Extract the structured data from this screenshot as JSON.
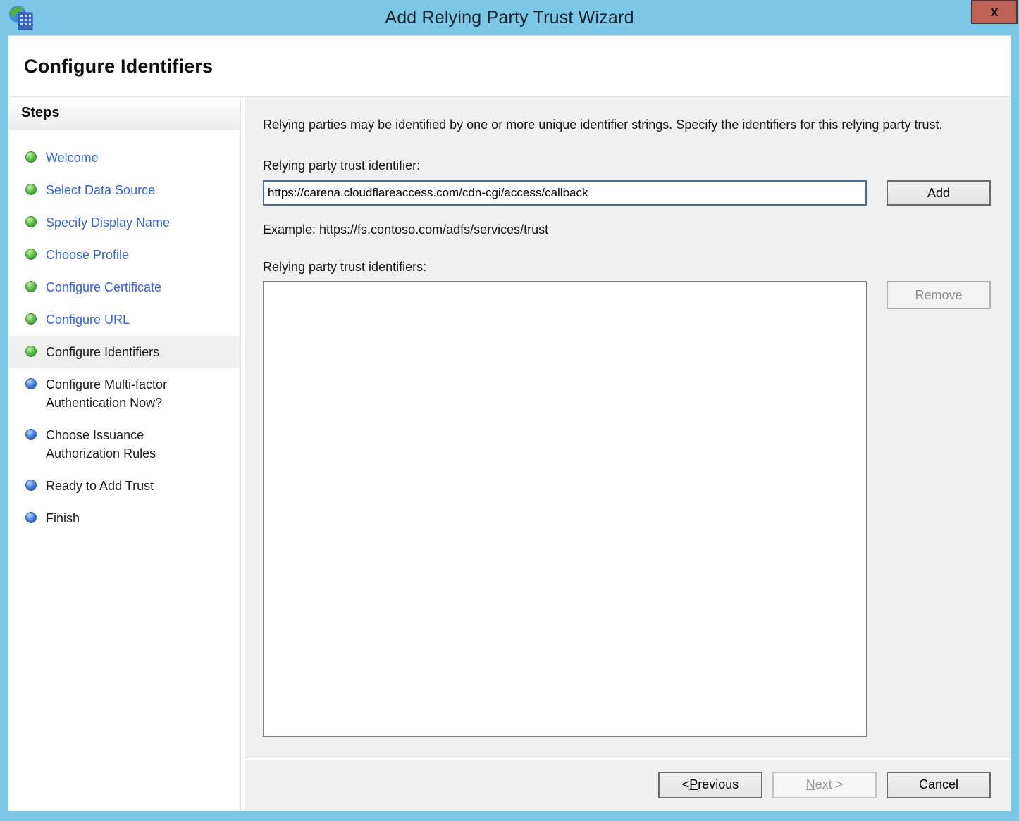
{
  "window": {
    "title": "Add Relying Party Trust Wizard",
    "close_label": "x"
  },
  "page": {
    "heading": "Configure Identifiers"
  },
  "sidebar": {
    "title": "Steps",
    "steps": [
      {
        "label": "Welcome",
        "status": "done"
      },
      {
        "label": "Select Data Source",
        "status": "done"
      },
      {
        "label": "Specify Display Name",
        "status": "done"
      },
      {
        "label": "Choose Profile",
        "status": "done"
      },
      {
        "label": "Configure Certificate",
        "status": "done"
      },
      {
        "label": "Configure URL",
        "status": "done"
      },
      {
        "label": "Configure Identifiers",
        "status": "current"
      },
      {
        "label": "Configure Multi-factor Authentication Now?",
        "status": "pending"
      },
      {
        "label": "Choose Issuance Authorization Rules",
        "status": "pending"
      },
      {
        "label": "Ready to Add Trust",
        "status": "pending"
      },
      {
        "label": "Finish",
        "status": "pending"
      }
    ]
  },
  "main": {
    "intro": "Relying parties may be identified by one or more unique identifier strings. Specify the identifiers for this relying party trust.",
    "identifier_label": "Relying party trust identifier:",
    "identifier_input": {
      "value": "https://carena.cloudflareaccess.com/cdn-cgi/access/callback"
    },
    "add_button": "Add",
    "example": "Example: https://fs.contoso.com/adfs/services/trust",
    "identifiers_list_label": "Relying party trust identifiers:",
    "identifiers": [],
    "remove_button": "Remove"
  },
  "footer": {
    "previous": {
      "pre": "< ",
      "key": "P",
      "rest": "revious"
    },
    "next": {
      "pre": "",
      "key": "N",
      "rest": "ext >"
    },
    "cancel": "Cancel"
  },
  "colors": {
    "titlebar_blue": "#7CC7E6",
    "close_button_red": "#BE6157",
    "completed_link_blue": "#3463E3",
    "completed_dot_green": "#46AC39",
    "pending_dot_blue": "#3A6FD8",
    "focused_input_border": "#4A6D94",
    "panel_gray": "#F0F0F0"
  }
}
